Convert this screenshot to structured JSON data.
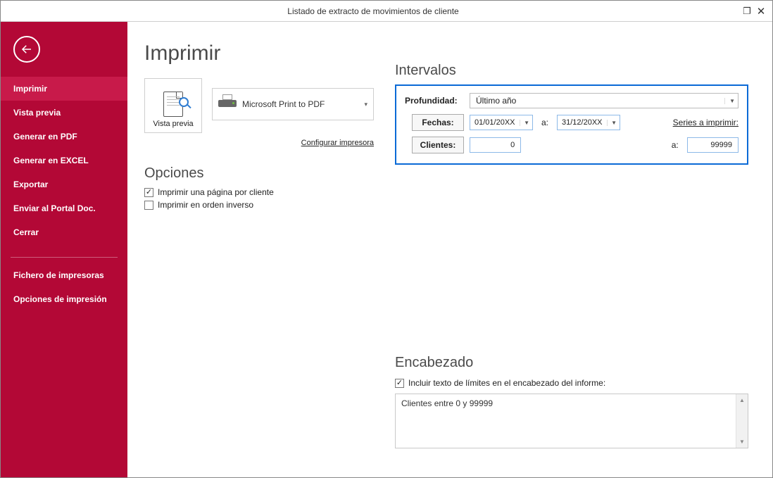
{
  "window": {
    "title": "Listado de extracto de movimientos de cliente"
  },
  "sidebar": {
    "items": [
      "Imprimir",
      "Vista previa",
      "Generar en PDF",
      "Generar en EXCEL",
      "Exportar",
      "Enviar al Portal Doc.",
      "Cerrar"
    ],
    "extra": [
      "Fichero de impresoras",
      "Opciones de impresión"
    ]
  },
  "page_title": "Imprimir",
  "preview_label": "Vista previa",
  "printer_name": "Microsoft Print to PDF",
  "config_link": "Configurar impresora",
  "opciones": {
    "heading": "Opciones",
    "opt1": "Imprimir una página por cliente",
    "opt2": "Imprimir en orden inverso"
  },
  "intervalos": {
    "heading": "Intervalos",
    "profundidad_label": "Profundidad:",
    "profundidad_value": "Último año",
    "fechas_label": "Fechas:",
    "fecha_desde": "01/01/20XX",
    "a_label": "a:",
    "fecha_hasta": "31/12/20XX",
    "series_link": "Series a imprimir:",
    "clientes_label": "Clientes:",
    "cliente_desde": "0",
    "cliente_hasta": "99999"
  },
  "encabezado": {
    "heading": "Encabezado",
    "chk_label": "Incluir texto de límites en el encabezado del informe:",
    "text": "Clientes entre 0 y 99999"
  }
}
